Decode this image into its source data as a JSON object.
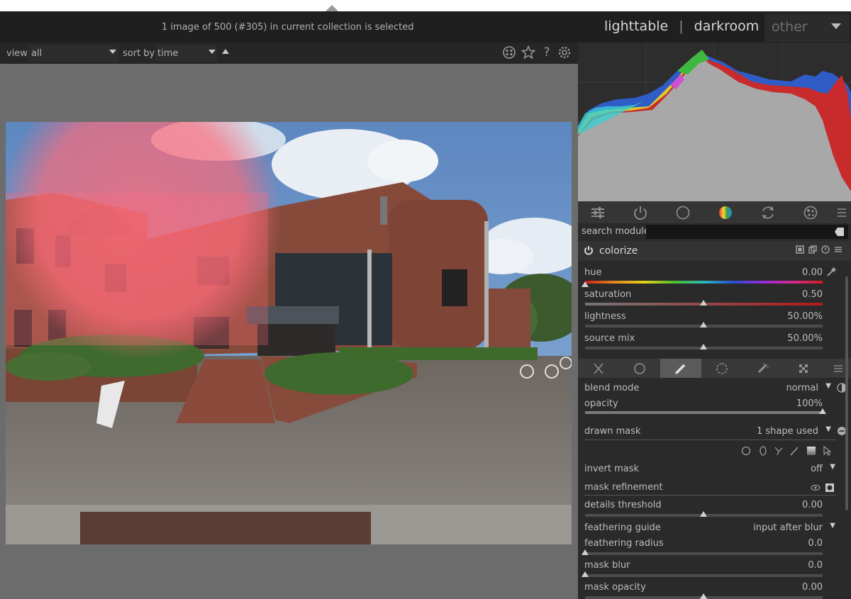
{
  "header": {
    "status": "1 image of 500 (#305) in current collection is selected",
    "views": {
      "lighttable": "lighttable",
      "darkroom": "darkroom",
      "other": "other",
      "sep": "|"
    }
  },
  "filterbar": {
    "view_label": "view",
    "view_value": "all",
    "sort_label": "sort by",
    "sort_value": "time",
    "icons": [
      "presets-icon",
      "star-icon",
      "help-icon",
      "settings-icon"
    ],
    "help_glyph": "?"
  },
  "image": {
    "description_icon": "photo-canvas"
  },
  "histogram": {
    "channels": [
      "red",
      "green",
      "blue"
    ]
  },
  "module_groups": {
    "icons": [
      "quick-access-icon",
      "active-modules-icon",
      "base-icon",
      "color-icon",
      "correct-icon",
      "effect-icon",
      "menu-icon"
    ],
    "active": "color-icon"
  },
  "search": {
    "label": "search module",
    "placeholder": ""
  },
  "module": {
    "name": "colorize",
    "sliders": [
      {
        "label": "hue",
        "value": "0.00",
        "fraction": 0.0
      },
      {
        "label": "saturation",
        "value": "0.50",
        "fraction": 0.5
      },
      {
        "label": "lightness",
        "value": "50.00%",
        "fraction": 0.5
      },
      {
        "label": "source mix",
        "value": "50.00%",
        "fraction": 0.5
      }
    ]
  },
  "blend": {
    "tabs": [
      "off-tab",
      "uniform-tab",
      "drawn-tab",
      "parametric-tab",
      "drawn-parametric-tab",
      "raster-tab"
    ],
    "active_tab": "drawn-tab",
    "blend_mode_label": "blend mode",
    "blend_mode_value": "normal",
    "opacity_label": "opacity",
    "opacity_value": "100%",
    "opacity_fraction": 1.0,
    "drawn_mask_label": "drawn mask",
    "drawn_mask_value": "1 shape used",
    "shape_tools": [
      "circle-icon",
      "ellipse-icon",
      "path-icon",
      "brush-icon",
      "gradient-icon",
      "edit-shapes-icon"
    ],
    "invert_mask_label": "invert mask",
    "invert_mask_value": "off",
    "mask_refinement_label": "mask refinement",
    "details_threshold_label": "details threshold",
    "details_threshold_value": "0.00",
    "details_threshold_fraction": 0.5,
    "feathering_guide_label": "feathering guide",
    "feathering_guide_value": "input after blur",
    "feathering_radius_label": "feathering radius",
    "feathering_radius_value": "0.0",
    "feathering_radius_fraction": 0.0,
    "mask_blur_label": "mask blur",
    "mask_blur_value": "0.0",
    "mask_blur_fraction": 0.0,
    "mask_opacity_label": "mask opacity",
    "mask_opacity_value": "0.00",
    "mask_opacity_fraction": 0.5
  },
  "colors": {
    "bg": "#1f1f1f",
    "panel": "#2a2a2a",
    "center": "#6c6c6c",
    "mask_overlay": "#ff6b7a"
  }
}
